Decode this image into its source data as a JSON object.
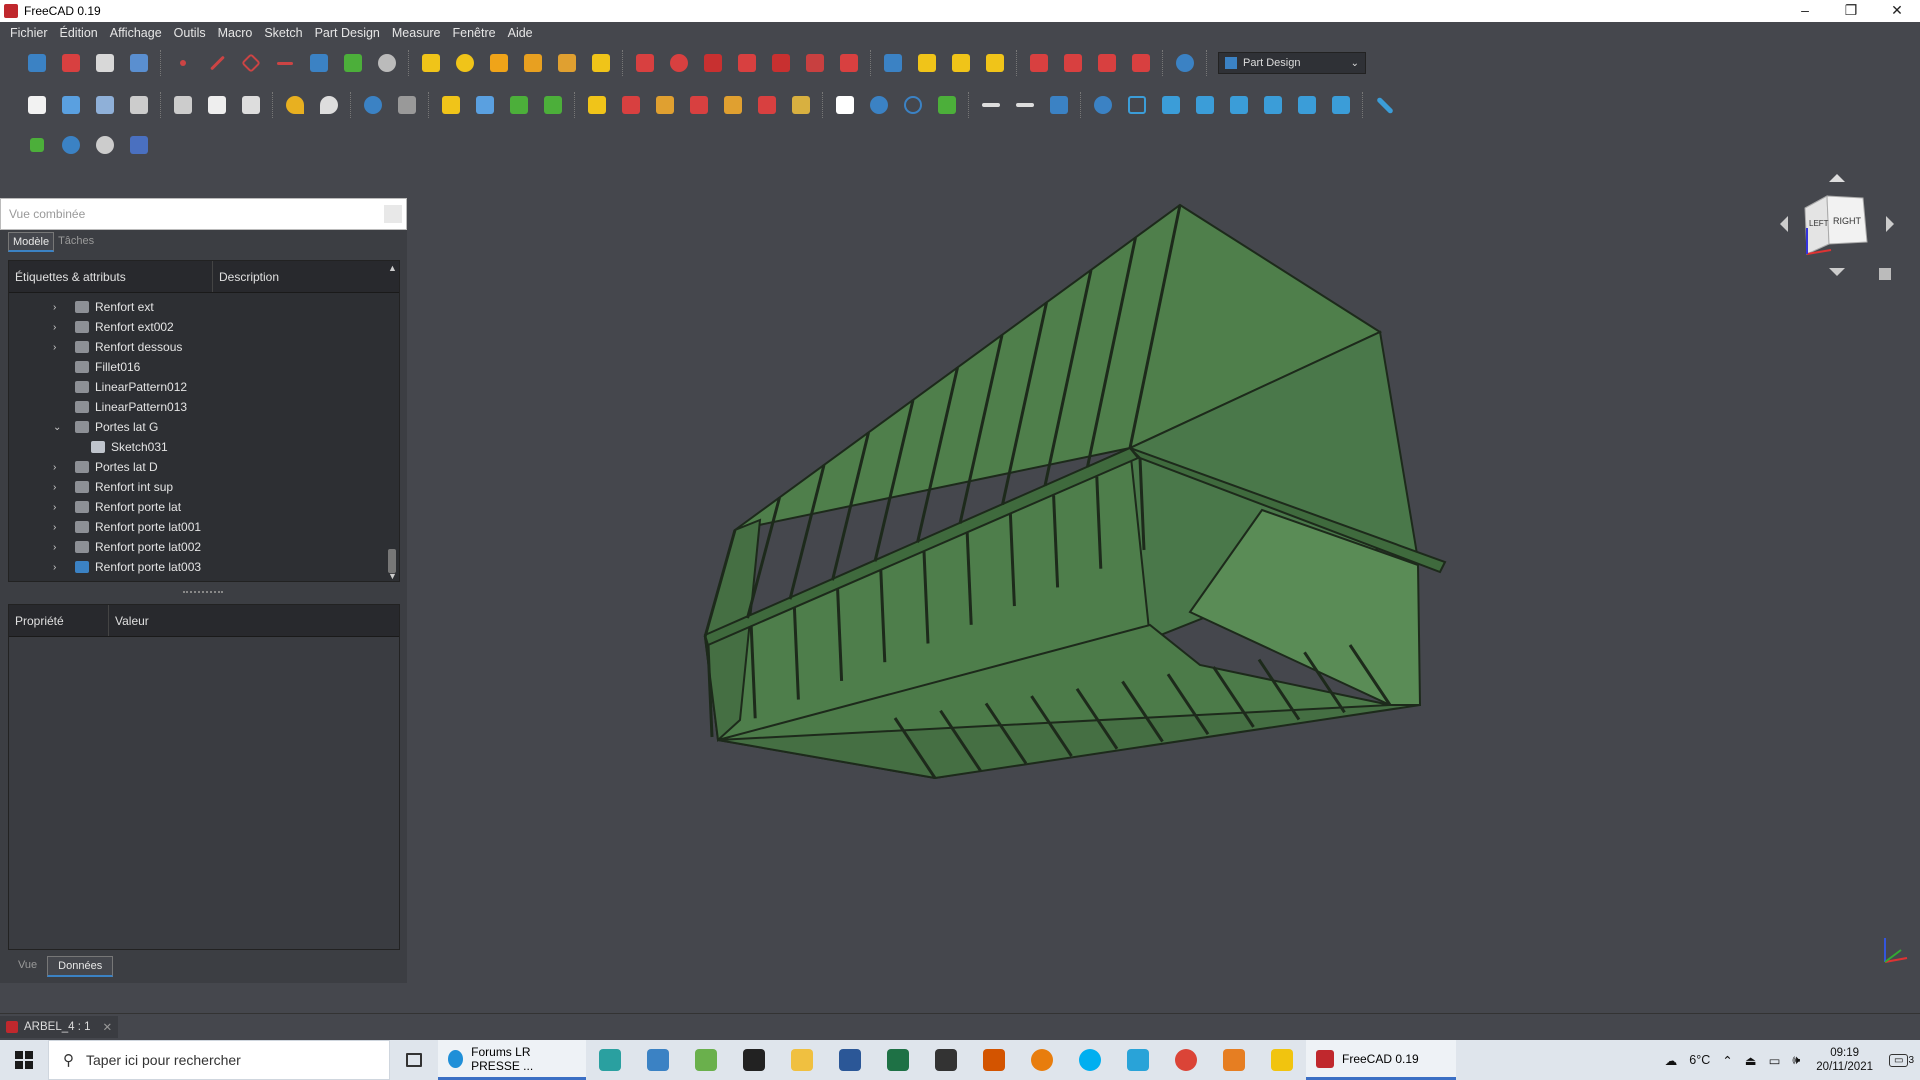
{
  "window": {
    "title": "FreeCAD 0.19",
    "minimize": "–",
    "maximize": "❐",
    "close": "✕"
  },
  "menu": [
    "Fichier",
    "Édition",
    "Affichage",
    "Outils",
    "Macro",
    "Sketch",
    "Part Design",
    "Measure",
    "Fenêtre",
    "Aide"
  ],
  "workbench": {
    "selected": "Part Design"
  },
  "combo": {
    "title": "Vue combinée",
    "tabs": [
      "Modèle",
      "Tâches"
    ],
    "tree_headers": [
      "Étiquettes & attributs",
      "Description"
    ],
    "tree_items": [
      {
        "label": "Renfort ext",
        "expander": "›"
      },
      {
        "label": "Renfort ext002",
        "expander": "›"
      },
      {
        "label": "Renfort dessous",
        "expander": "›"
      },
      {
        "label": "Fillet016",
        "expander": ""
      },
      {
        "label": "LinearPattern012",
        "expander": ""
      },
      {
        "label": "LinearPattern013",
        "expander": ""
      },
      {
        "label": "Portes lat G",
        "expander": "⌄"
      },
      {
        "label": "Sketch031",
        "expander": ""
      },
      {
        "label": "Portes lat D",
        "expander": "›"
      },
      {
        "label": "Renfort int sup",
        "expander": "›"
      },
      {
        "label": "Renfort porte lat",
        "expander": "›"
      },
      {
        "label": "Renfort porte lat001",
        "expander": "›"
      },
      {
        "label": "Renfort porte lat002",
        "expander": "›"
      },
      {
        "label": "Renfort porte lat003",
        "expander": "›"
      }
    ],
    "props_headers": [
      "Propriété",
      "Valeur"
    ],
    "bottom_tabs": [
      "Vue",
      "Données"
    ]
  },
  "navcube": {
    "face_front": "LEFT",
    "face_right": "RIGHT"
  },
  "document_tab": {
    "label": "ARBEL_4 : 1",
    "close": "✕"
  },
  "taskbar": {
    "search_placeholder": "Taper ici pour rechercher",
    "edge_label": "Forums LR PRESSE ...",
    "freecad_label": "FreeCAD 0.19",
    "temperature": "6°C",
    "time": "09:19",
    "date": "20/11/2021",
    "notifications": "3"
  },
  "colors": {
    "model_green": "#4e7d4b",
    "model_edge": "#1d2a1b",
    "background": "#45474d",
    "accent": "#3b82c4"
  }
}
